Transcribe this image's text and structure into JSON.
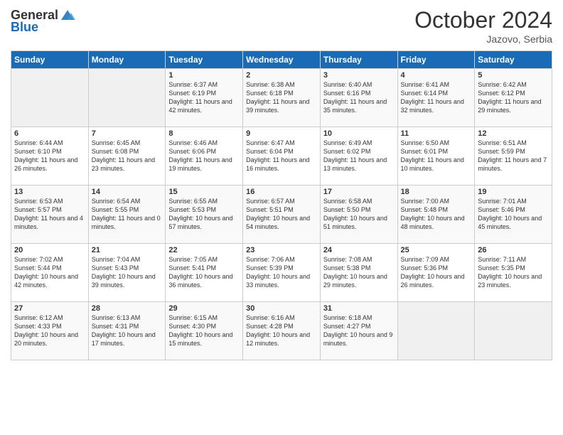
{
  "header": {
    "logo_general": "General",
    "logo_blue": "Blue",
    "month": "October 2024",
    "location": "Jazovo, Serbia"
  },
  "days_of_week": [
    "Sunday",
    "Monday",
    "Tuesday",
    "Wednesday",
    "Thursday",
    "Friday",
    "Saturday"
  ],
  "weeks": [
    [
      {
        "day": "",
        "info": ""
      },
      {
        "day": "",
        "info": ""
      },
      {
        "day": "1",
        "info": "Sunrise: 6:37 AM\nSunset: 6:19 PM\nDaylight: 11 hours and 42 minutes."
      },
      {
        "day": "2",
        "info": "Sunrise: 6:38 AM\nSunset: 6:18 PM\nDaylight: 11 hours and 39 minutes."
      },
      {
        "day": "3",
        "info": "Sunrise: 6:40 AM\nSunset: 6:16 PM\nDaylight: 11 hours and 35 minutes."
      },
      {
        "day": "4",
        "info": "Sunrise: 6:41 AM\nSunset: 6:14 PM\nDaylight: 11 hours and 32 minutes."
      },
      {
        "day": "5",
        "info": "Sunrise: 6:42 AM\nSunset: 6:12 PM\nDaylight: 11 hours and 29 minutes."
      }
    ],
    [
      {
        "day": "6",
        "info": "Sunrise: 6:44 AM\nSunset: 6:10 PM\nDaylight: 11 hours and 26 minutes."
      },
      {
        "day": "7",
        "info": "Sunrise: 6:45 AM\nSunset: 6:08 PM\nDaylight: 11 hours and 23 minutes."
      },
      {
        "day": "8",
        "info": "Sunrise: 6:46 AM\nSunset: 6:06 PM\nDaylight: 11 hours and 19 minutes."
      },
      {
        "day": "9",
        "info": "Sunrise: 6:47 AM\nSunset: 6:04 PM\nDaylight: 11 hours and 16 minutes."
      },
      {
        "day": "10",
        "info": "Sunrise: 6:49 AM\nSunset: 6:02 PM\nDaylight: 11 hours and 13 minutes."
      },
      {
        "day": "11",
        "info": "Sunrise: 6:50 AM\nSunset: 6:01 PM\nDaylight: 11 hours and 10 minutes."
      },
      {
        "day": "12",
        "info": "Sunrise: 6:51 AM\nSunset: 5:59 PM\nDaylight: 11 hours and 7 minutes."
      }
    ],
    [
      {
        "day": "13",
        "info": "Sunrise: 6:53 AM\nSunset: 5:57 PM\nDaylight: 11 hours and 4 minutes."
      },
      {
        "day": "14",
        "info": "Sunrise: 6:54 AM\nSunset: 5:55 PM\nDaylight: 11 hours and 0 minutes."
      },
      {
        "day": "15",
        "info": "Sunrise: 6:55 AM\nSunset: 5:53 PM\nDaylight: 10 hours and 57 minutes."
      },
      {
        "day": "16",
        "info": "Sunrise: 6:57 AM\nSunset: 5:51 PM\nDaylight: 10 hours and 54 minutes."
      },
      {
        "day": "17",
        "info": "Sunrise: 6:58 AM\nSunset: 5:50 PM\nDaylight: 10 hours and 51 minutes."
      },
      {
        "day": "18",
        "info": "Sunrise: 7:00 AM\nSunset: 5:48 PM\nDaylight: 10 hours and 48 minutes."
      },
      {
        "day": "19",
        "info": "Sunrise: 7:01 AM\nSunset: 5:46 PM\nDaylight: 10 hours and 45 minutes."
      }
    ],
    [
      {
        "day": "20",
        "info": "Sunrise: 7:02 AM\nSunset: 5:44 PM\nDaylight: 10 hours and 42 minutes."
      },
      {
        "day": "21",
        "info": "Sunrise: 7:04 AM\nSunset: 5:43 PM\nDaylight: 10 hours and 39 minutes."
      },
      {
        "day": "22",
        "info": "Sunrise: 7:05 AM\nSunset: 5:41 PM\nDaylight: 10 hours and 36 minutes."
      },
      {
        "day": "23",
        "info": "Sunrise: 7:06 AM\nSunset: 5:39 PM\nDaylight: 10 hours and 33 minutes."
      },
      {
        "day": "24",
        "info": "Sunrise: 7:08 AM\nSunset: 5:38 PM\nDaylight: 10 hours and 29 minutes."
      },
      {
        "day": "25",
        "info": "Sunrise: 7:09 AM\nSunset: 5:36 PM\nDaylight: 10 hours and 26 minutes."
      },
      {
        "day": "26",
        "info": "Sunrise: 7:11 AM\nSunset: 5:35 PM\nDaylight: 10 hours and 23 minutes."
      }
    ],
    [
      {
        "day": "27",
        "info": "Sunrise: 6:12 AM\nSunset: 4:33 PM\nDaylight: 10 hours and 20 minutes."
      },
      {
        "day": "28",
        "info": "Sunrise: 6:13 AM\nSunset: 4:31 PM\nDaylight: 10 hours and 17 minutes."
      },
      {
        "day": "29",
        "info": "Sunrise: 6:15 AM\nSunset: 4:30 PM\nDaylight: 10 hours and 15 minutes."
      },
      {
        "day": "30",
        "info": "Sunrise: 6:16 AM\nSunset: 4:28 PM\nDaylight: 10 hours and 12 minutes."
      },
      {
        "day": "31",
        "info": "Sunrise: 6:18 AM\nSunset: 4:27 PM\nDaylight: 10 hours and 9 minutes."
      },
      {
        "day": "",
        "info": ""
      },
      {
        "day": "",
        "info": ""
      }
    ]
  ]
}
